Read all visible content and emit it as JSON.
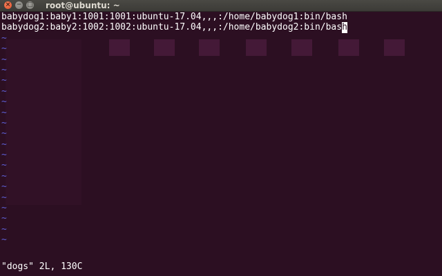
{
  "window": {
    "title": "root@ubuntu: ~",
    "close_glyph": "×",
    "min_glyph": "−",
    "max_glyph": "□"
  },
  "editor": {
    "lines": [
      "babydog1:baby1:1001:1001:ubuntu-17.04,,,:/home/babydog1:bin/bash",
      "babydog2:baby2:1002:1002:ubuntu-17.04,,,:/home/babydog2:bin/bas"
    ],
    "cursor_char": "h",
    "empty_marker": "~",
    "empty_line_count": 20,
    "status": "\"dogs\" 2L, 130C"
  },
  "colors": {
    "terminal_bg": "#2c0f22",
    "text": "#ffffff",
    "tilde": "#5f5fd7",
    "close_button": "#e1502a"
  }
}
